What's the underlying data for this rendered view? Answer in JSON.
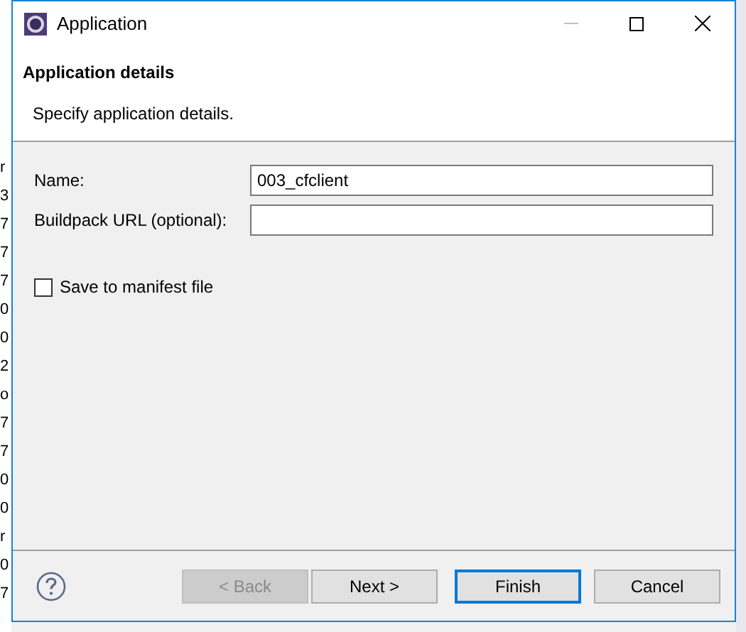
{
  "background_fragments": [
    "r",
    "3",
    "7",
    "7",
    "7",
    "0",
    "0",
    "2",
    "o",
    "7",
    "7",
    "0",
    "0",
    "r",
    "0",
    "7"
  ],
  "window": {
    "title": "Application"
  },
  "header": {
    "title": "Application details",
    "description": "Specify application details."
  },
  "fields": [
    {
      "label": "Name:",
      "value": "003_cfclient"
    },
    {
      "label": "Buildpack URL (optional):"
    }
  ],
  "options": [
    {
      "label": "Save to manifest file",
      "checked": false
    }
  ],
  "buttons": [
    {
      "label": "< Back",
      "disabled": true,
      "default": false
    },
    {
      "label": "Next >",
      "disabled": false,
      "default": false
    },
    {
      "label": "Finish",
      "disabled": false,
      "default": true
    },
    {
      "label": "Cancel",
      "disabled": false,
      "default": false
    }
  ]
}
